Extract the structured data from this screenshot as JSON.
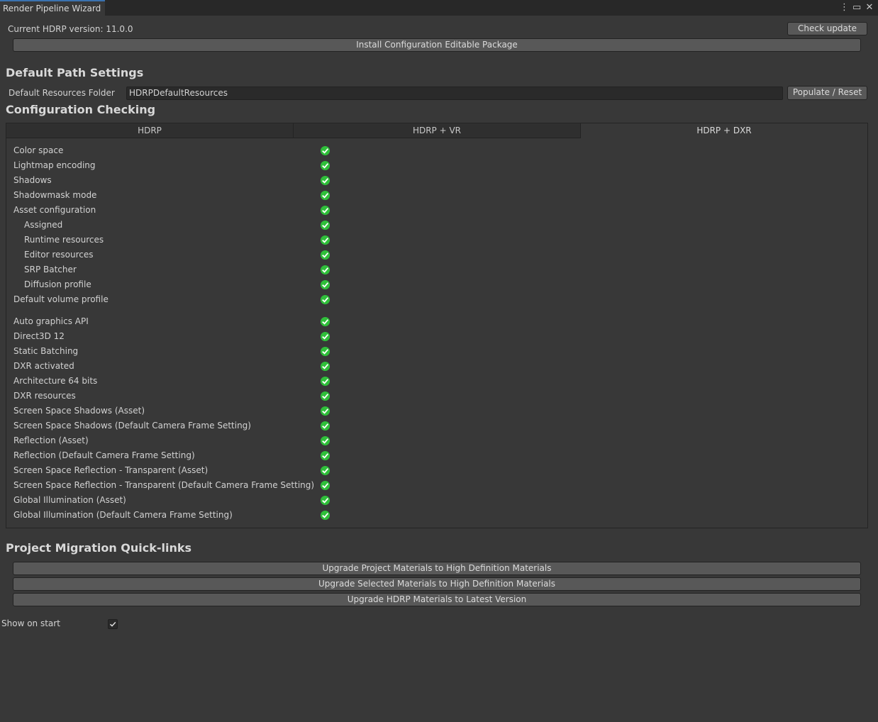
{
  "window": {
    "title": "Render Pipeline Wizard"
  },
  "header": {
    "version_text": "Current HDRP version: 11.0.0",
    "check_update_label": "Check update",
    "install_package_label": "Install Configuration Editable Package"
  },
  "default_path": {
    "heading": "Default Path Settings",
    "resources_label": "Default Resources Folder",
    "resources_value": "HDRPDefaultResources",
    "populate_label": "Populate / Reset"
  },
  "config": {
    "heading": "Configuration Checking",
    "tabs": [
      {
        "label": "HDRP",
        "active": false
      },
      {
        "label": "HDRP + VR",
        "active": false
      },
      {
        "label": "HDRP + DXR",
        "active": true
      }
    ],
    "checks": [
      {
        "label": "Color space",
        "indent": false,
        "ok": true
      },
      {
        "label": "Lightmap encoding",
        "indent": false,
        "ok": true
      },
      {
        "label": "Shadows",
        "indent": false,
        "ok": true
      },
      {
        "label": "Shadowmask mode",
        "indent": false,
        "ok": true
      },
      {
        "label": "Asset configuration",
        "indent": false,
        "ok": true
      },
      {
        "label": "Assigned",
        "indent": true,
        "ok": true
      },
      {
        "label": "Runtime resources",
        "indent": true,
        "ok": true
      },
      {
        "label": "Editor resources",
        "indent": true,
        "ok": true
      },
      {
        "label": "SRP Batcher",
        "indent": true,
        "ok": true
      },
      {
        "label": "Diffusion profile",
        "indent": true,
        "ok": true
      },
      {
        "label": "Default volume profile",
        "indent": false,
        "ok": true
      },
      {
        "label": "Auto graphics API",
        "indent": false,
        "ok": true
      },
      {
        "label": "Direct3D 12",
        "indent": false,
        "ok": true
      },
      {
        "label": "Static Batching",
        "indent": false,
        "ok": true
      },
      {
        "label": "DXR activated",
        "indent": false,
        "ok": true
      },
      {
        "label": "Architecture 64 bits",
        "indent": false,
        "ok": true
      },
      {
        "label": "DXR resources",
        "indent": false,
        "ok": true
      },
      {
        "label": "Screen Space Shadows (Asset)",
        "indent": false,
        "ok": true
      },
      {
        "label": "Screen Space Shadows (Default Camera Frame Setting)",
        "indent": false,
        "ok": true
      },
      {
        "label": "Reflection (Asset)",
        "indent": false,
        "ok": true
      },
      {
        "label": "Reflection (Default Camera Frame Setting)",
        "indent": false,
        "ok": true
      },
      {
        "label": "Screen Space Reflection - Transparent (Asset)",
        "indent": false,
        "ok": true
      },
      {
        "label": "Screen Space Reflection - Transparent (Default Camera Frame Setting)",
        "indent": false,
        "ok": true
      },
      {
        "label": "Global Illumination (Asset)",
        "indent": false,
        "ok": true
      },
      {
        "label": "Global Illumination (Default Camera Frame Setting)",
        "indent": false,
        "ok": true
      }
    ]
  },
  "migration": {
    "heading": "Project Migration Quick-links",
    "buttons": [
      "Upgrade Project Materials to High Definition Materials",
      "Upgrade Selected Materials to High Definition Materials",
      "Upgrade HDRP Materials to Latest Version"
    ]
  },
  "footer": {
    "show_on_start_label": "Show on start",
    "show_on_start_checked": true
  },
  "colors": {
    "background": "#383838",
    "ok_green": "#2fbf3a",
    "tab_accent": "#3a72b0"
  }
}
